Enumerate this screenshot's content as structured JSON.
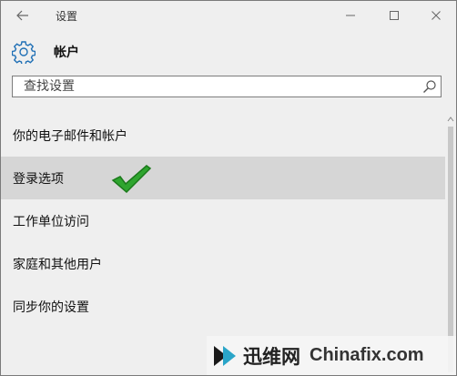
{
  "window": {
    "title": "设置"
  },
  "header": {
    "icon": "gear-icon",
    "title": "帐户"
  },
  "search": {
    "placeholder": "查找设置",
    "value": ""
  },
  "menu": {
    "items": [
      {
        "label": "你的电子邮件和帐户",
        "selected": false
      },
      {
        "label": "登录选项",
        "selected": true
      },
      {
        "label": "工作单位访问",
        "selected": false
      },
      {
        "label": "家庭和其他用户",
        "selected": false
      },
      {
        "label": "同步你的设置",
        "selected": false
      }
    ]
  },
  "colors": {
    "accent": "#1f6fb5",
    "selected_bg": "#d6d6d6",
    "check_green": "#2fa52f"
  },
  "watermark": {
    "brand": "迅维网",
    "site": "Chinafix.com"
  }
}
